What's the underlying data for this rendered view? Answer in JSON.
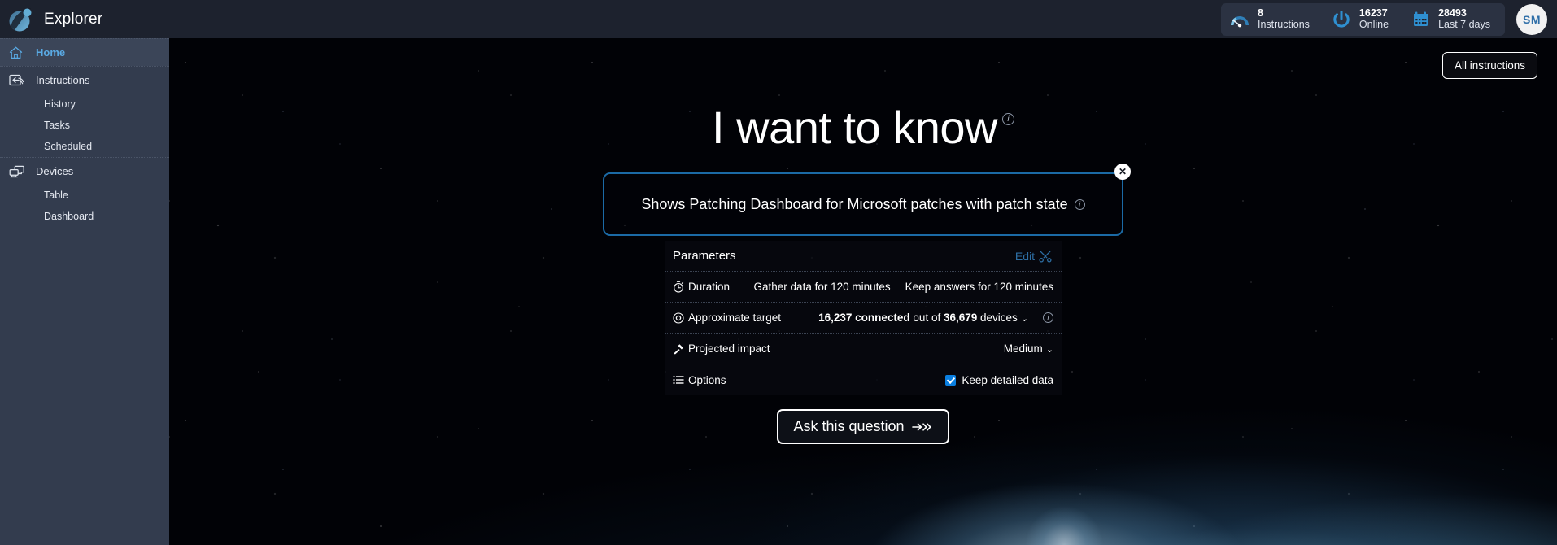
{
  "header": {
    "brand": "Explorer",
    "stats": [
      {
        "icon": "gauge-icon",
        "value": "8",
        "label": "Instructions"
      },
      {
        "icon": "power-icon",
        "value": "16237",
        "label": "Online"
      },
      {
        "icon": "calendar-icon",
        "value": "28493",
        "label": "Last 7 days"
      }
    ],
    "avatar_initials": "SM"
  },
  "sidebar": {
    "items": [
      {
        "label": "Home",
        "icon": "home-icon",
        "active": true,
        "level": 0
      },
      {
        "label": "Instructions",
        "icon": "instructions-icon",
        "active": false,
        "level": 0
      },
      {
        "label": "History",
        "icon": "",
        "active": false,
        "level": 1
      },
      {
        "label": "Tasks",
        "icon": "",
        "active": false,
        "level": 1
      },
      {
        "label": "Scheduled",
        "icon": "",
        "active": false,
        "level": 1
      },
      {
        "label": "Devices",
        "icon": "devices-icon",
        "active": false,
        "level": 0
      },
      {
        "label": "Table",
        "icon": "",
        "active": false,
        "level": 1
      },
      {
        "label": "Dashboard",
        "icon": "",
        "active": false,
        "level": 1
      }
    ]
  },
  "main": {
    "all_instructions_label": "All instructions",
    "headline": "I want to know",
    "headline_info": "i",
    "question": {
      "text": "Shows Patching Dashboard for Microsoft patches with patch state",
      "info": "i",
      "close": "✕"
    },
    "parameters": {
      "title": "Parameters",
      "edit_label": "Edit",
      "rows": [
        {
          "id": "duration",
          "icon": "stopwatch-icon",
          "label": "Duration",
          "values": [
            "Gather data for 120 minutes",
            "Keep answers for 120 minutes"
          ]
        },
        {
          "id": "approximate-target",
          "icon": "target-icon",
          "label": "Approximate target",
          "connected": "16,237 connected",
          "out_of_prefix": " out of ",
          "total": "36,679",
          "devices_word": " devices",
          "chevron": "⌄",
          "info": "i"
        },
        {
          "id": "projected-impact",
          "icon": "hammer-icon",
          "label": "Projected impact",
          "value": "Medium",
          "chevron": "⌄"
        },
        {
          "id": "options",
          "icon": "list-icon",
          "label": "Options",
          "checkbox_label": "Keep detailed data",
          "checked": true
        }
      ]
    },
    "ask_button": "Ask this question"
  },
  "colors": {
    "header_bg": "#1d222e",
    "sidebar_bg": "#333c4e",
    "accent_blue": "#5aaae4",
    "link_blue": "#2d6ea3",
    "question_border": "#1b6aa5",
    "checkbox": "#0a7fe0"
  }
}
